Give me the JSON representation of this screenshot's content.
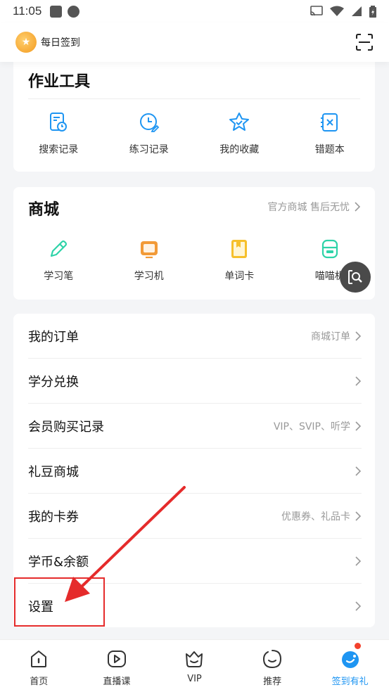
{
  "status_bar": {
    "time": "11:05"
  },
  "header": {
    "checkin_label": "每日签到"
  },
  "homework_tools": {
    "title": "作业工具",
    "items": [
      {
        "label": "搜索记录",
        "icon": "search-history-icon"
      },
      {
        "label": "练习记录",
        "icon": "practice-history-icon"
      },
      {
        "label": "我的收藏",
        "icon": "favorites-star-icon"
      },
      {
        "label": "错题本",
        "icon": "wrong-questions-icon"
      }
    ]
  },
  "mall": {
    "title": "商城",
    "subtitle": "官方商城  售后无忧",
    "items": [
      {
        "label": "学习笔",
        "icon": "pen-icon"
      },
      {
        "label": "学习机",
        "icon": "tablet-icon"
      },
      {
        "label": "单词卡",
        "icon": "word-card-icon"
      },
      {
        "label": "喵喵机",
        "icon": "printer-icon"
      }
    ]
  },
  "menu": {
    "rows": [
      {
        "label": "我的订单",
        "hint": "商城订单"
      },
      {
        "label": "学分兑换",
        "hint": ""
      },
      {
        "label": "会员购买记录",
        "hint": "VIP、SVIP、听学"
      },
      {
        "label": "礼豆商城",
        "hint": ""
      },
      {
        "label": "我的卡券",
        "hint": "优惠券、礼品卡"
      },
      {
        "label": "学币&余额",
        "hint": ""
      },
      {
        "label": "设置",
        "hint": ""
      }
    ]
  },
  "tabbar": {
    "tabs": [
      {
        "label": "首页",
        "icon": "home-icon"
      },
      {
        "label": "直播课",
        "icon": "live-class-icon"
      },
      {
        "label": "VIP",
        "icon": "vip-icon"
      },
      {
        "label": "推荐",
        "icon": "recommend-icon"
      },
      {
        "label": "签到有礼",
        "icon": "checkin-gift-icon"
      }
    ],
    "active_index": 4
  },
  "colors": {
    "accent": "#1e95f2",
    "mall_green": "#2ed3a8",
    "mall_orange": "#f29a37",
    "mall_yellow": "#f6c02c",
    "annotation_red": "#e52b2b"
  }
}
